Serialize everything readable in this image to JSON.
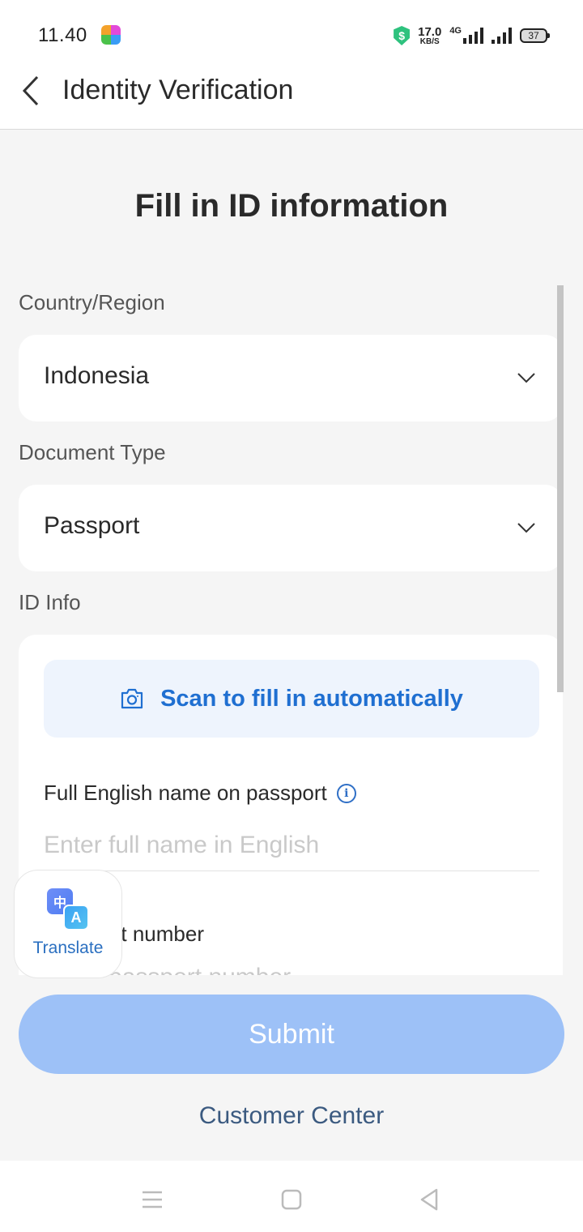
{
  "status_bar": {
    "time": "11.40",
    "net_speed_value": "17.0",
    "net_speed_unit": "KB/S",
    "network_type": "4G",
    "battery": "37"
  },
  "header": {
    "title": "Identity Verification",
    "back_icon": "chevron-left-icon"
  },
  "page": {
    "heading": "Fill in ID information"
  },
  "country": {
    "label": "Country/Region",
    "value": "Indonesia"
  },
  "document_type": {
    "label": "Document Type",
    "value": "Passport"
  },
  "id_info": {
    "label": "ID Info",
    "scan_label": "Scan to fill in automatically",
    "full_name_label": "Full English name on passport",
    "full_name_placeholder": "Enter full name in English",
    "full_name_value": "",
    "passport_label": "Passport number",
    "passport_placeholder": "Enter passport number",
    "passport_value": ""
  },
  "translate": {
    "label": "Translate",
    "zh_glyph": "中",
    "en_glyph": "A"
  },
  "actions": {
    "submit_label": "Submit",
    "customer_center_label": "Customer Center"
  },
  "colors": {
    "accent": "#1f6fd1",
    "submit_disabled": "#9dc1f7",
    "background": "#f5f5f5"
  }
}
